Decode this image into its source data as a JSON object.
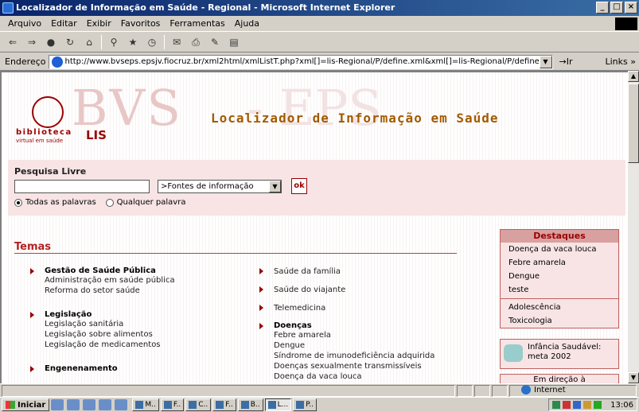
{
  "window": {
    "title": "Localizador de Informação em Saúde - Regional - Microsoft Internet Explorer",
    "min": "_",
    "max": "□",
    "close": "×"
  },
  "menu": [
    "Arquivo",
    "Editar",
    "Exibir",
    "Favoritos",
    "Ferramentas",
    "Ajuda"
  ],
  "toolbar_icons": [
    "back-icon",
    "forward-icon",
    "stop-icon",
    "refresh-icon",
    "home-icon",
    "search-icon",
    "favorites-icon",
    "history-icon",
    "mail-icon",
    "print-icon",
    "edit-icon",
    "discuss-icon"
  ],
  "address": {
    "label": "Endereço",
    "url": "http://www.bvseps.epsjv.fiocruz.br/xml2html/xmlListT.php?xml[]=lis-Regional/P/define.xml&xml[]=lis-Regional/P/defineConter",
    "go": "Ir",
    "links": "Links"
  },
  "header": {
    "biblioteca": "biblioteca",
    "virtual": "virtual em saúde",
    "lis": "LIS",
    "bvs": "BVS",
    "eps": "- EPS",
    "title": "Localizador de Informação em Saúde"
  },
  "search": {
    "title": "Pesquisa Livre",
    "select": ">Fontes de informação",
    "ok": "ok",
    "radio_all": "Todas as palavras",
    "radio_any": "Qualquer palavra"
  },
  "temas": {
    "title": "Temas"
  },
  "col1": [
    {
      "head": "Gestão de Saúde Pública",
      "subs": [
        "Administração em saúde pública",
        "Reforma do setor saúde"
      ]
    },
    {
      "head": "Legislação",
      "subs": [
        "Legislação sanitária",
        "Legislação sobre alimentos",
        "Legislação de medicamentos"
      ]
    },
    {
      "head": "Engenenamento",
      "subs": []
    }
  ],
  "col2": [
    {
      "head": "Saúde da família",
      "subs": []
    },
    {
      "head": "Saúde do viajante",
      "subs": []
    },
    {
      "head": "Telemedicina",
      "subs": []
    },
    {
      "head": "Doenças",
      "subs": [
        "Febre amarela",
        "Dengue",
        "Síndrome de imunodeficiência adquirida",
        "Doenças sexualmente transmissíveis",
        "Doença da vaca louca"
      ]
    }
  ],
  "destaques": {
    "title": "Destaques",
    "group1": [
      "Doença da vaca louca",
      "Febre amarela",
      "Dengue",
      "teste"
    ],
    "group2": [
      "Adolescência",
      "Toxicologia"
    ]
  },
  "infancia": {
    "line1": "Infância Saudável:",
    "line2": "meta 2002"
  },
  "emdirecao": "Em direção à",
  "status": {
    "zone": "Internet"
  },
  "taskbar": {
    "start": "Iniciar",
    "buttons": [
      "M..",
      "F..",
      "C..",
      "F..",
      "B..",
      "L...",
      "P.."
    ],
    "active": 5,
    "clock": "13:06"
  }
}
